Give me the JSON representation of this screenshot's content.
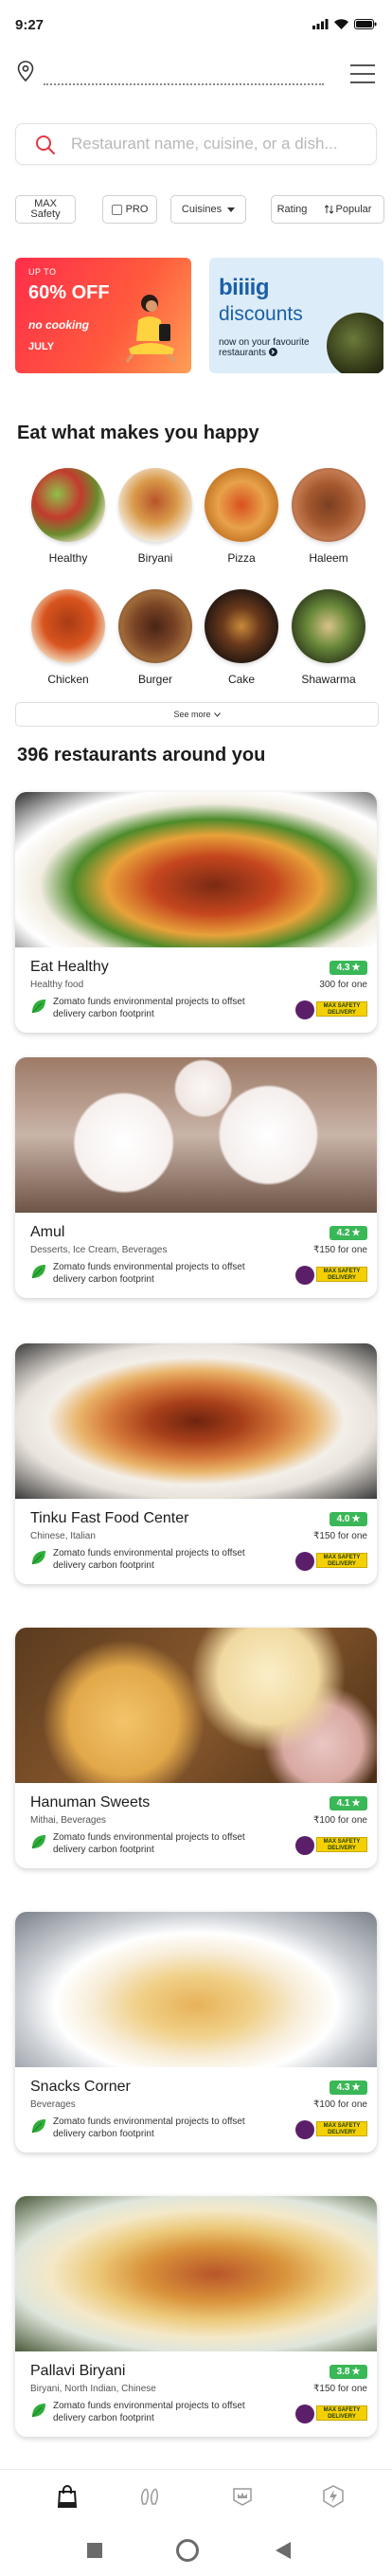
{
  "status": {
    "time": "9:27"
  },
  "search": {
    "placeholder": "Restaurant name, cuisine, or a dish..."
  },
  "filters": {
    "max_safety": [
      "MAX",
      "Safety"
    ],
    "pro": "PRO",
    "cuisines": "Cuisines",
    "rating": "Rating",
    "popular": "Popular"
  },
  "banners": {
    "left": {
      "upto": "UP TO",
      "percent": "60% OFF",
      "line": "no cooking",
      "month": "JULY"
    },
    "right": {
      "brand": "biiiig",
      "title": "discounts",
      "subtitle": "now on your favourite restaurants"
    }
  },
  "sections": {
    "happy": "Eat what makes you happy",
    "see_more": "See more",
    "restaurants_count": "396 restaurants around you"
  },
  "cuisines": [
    "Healthy",
    "Biryani",
    "Pizza",
    "Haleem",
    "Chicken",
    "Burger",
    "Cake",
    "Shawarma"
  ],
  "eco_text": "Zomato funds environmental projects to offset delivery carbon footprint",
  "safety_badge": "MAX SAFETY DELIVERY",
  "restaurants": [
    {
      "name": "Eat Healthy",
      "cuisine": "Healthy food",
      "rating": "4.3",
      "price": "300 for one"
    },
    {
      "name": "Amul",
      "cuisine": "Desserts, Ice Cream, Beverages",
      "rating": "4.2",
      "price": "₹150 for one"
    },
    {
      "name": "Tinku Fast Food Center",
      "cuisine": "Chinese, Italian",
      "rating": "4.0",
      "price": "₹150 for one"
    },
    {
      "name": "Hanuman Sweets",
      "cuisine": "Mithai, Beverages",
      "rating": "4.1",
      "price": "₹100 for one"
    },
    {
      "name": "Snacks Corner",
      "cuisine": "Beverages",
      "rating": "4.3",
      "price": "₹100 for one"
    },
    {
      "name": "Pallavi Biryani",
      "cuisine": "Biryani, North Indian, Chinese",
      "rating": "3.8",
      "price": "₹150 for one"
    }
  ],
  "icons": {
    "location": "location-pin-icon",
    "menu": "hamburger-menu-icon",
    "search": "search-icon",
    "star": "star-icon",
    "leaf": "leaf-icon",
    "nav": [
      "delivery-bag-icon",
      "dining-out-icon",
      "pro-icon",
      "flash-icon"
    ]
  },
  "colors": {
    "brand_red": "#e23744",
    "rating_green": "#3ab757",
    "safety_yellow": "#f5d000",
    "safety_purple": "#5b1f6a"
  }
}
